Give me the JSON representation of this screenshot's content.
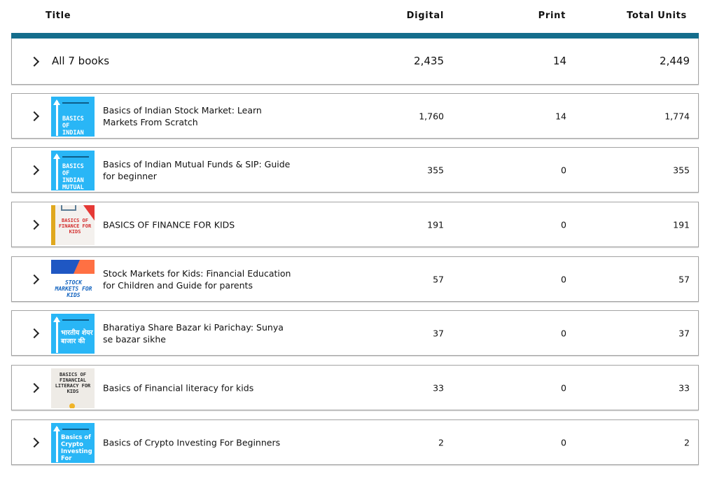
{
  "header": {
    "title": "Title",
    "digital": "Digital",
    "print": "Print",
    "total": "Total Units"
  },
  "summary": {
    "label": "All 7 books",
    "digital": "2,435",
    "print": "14",
    "total": "2,449"
  },
  "books": [
    {
      "title": "Basics of Indian Stock Market: Learn Markets From Scratch",
      "digital": "1,760",
      "print": "14",
      "total": "1,774",
      "cover_text": "BASICS OF INDIAN STOCK"
    },
    {
      "title": "Basics of Indian Mutual Funds & SIP: Guide for beginner",
      "digital": "355",
      "print": "0",
      "total": "355",
      "cover_text": "BASICS OF INDIAN MUTUAL FUNDS &"
    },
    {
      "title": "BASICS OF FINANCE FOR KIDS",
      "digital": "191",
      "print": "0",
      "total": "191",
      "cover_text": "BASICS OF FINANCE FOR KIDS"
    },
    {
      "title": "Stock Markets for Kids: Financial Education for Children and Guide for parents",
      "digital": "57",
      "print": "0",
      "total": "57",
      "cover_text": "STOCK MARKETS FOR KIDS"
    },
    {
      "title": "Bharatiya Share Bazar ki Parichay: Sunya se bazar sikhe",
      "digital": "37",
      "print": "0",
      "total": "37",
      "cover_text": "भारतीय शेयर बाजार की"
    },
    {
      "title": "Basics of Financial literacy for kids",
      "digital": "33",
      "print": "0",
      "total": "33",
      "cover_text": "BASICS OF FINANCIAL LITERACY FOR KIDS"
    },
    {
      "title": "Basics of Crypto Investing For Beginners",
      "digital": "2",
      "print": "0",
      "total": "2",
      "cover_text": "Basics of Crypto Investing For"
    }
  ],
  "colors": {
    "accent_bar": "#146d8c",
    "cover_blue": "#29b6f6"
  }
}
